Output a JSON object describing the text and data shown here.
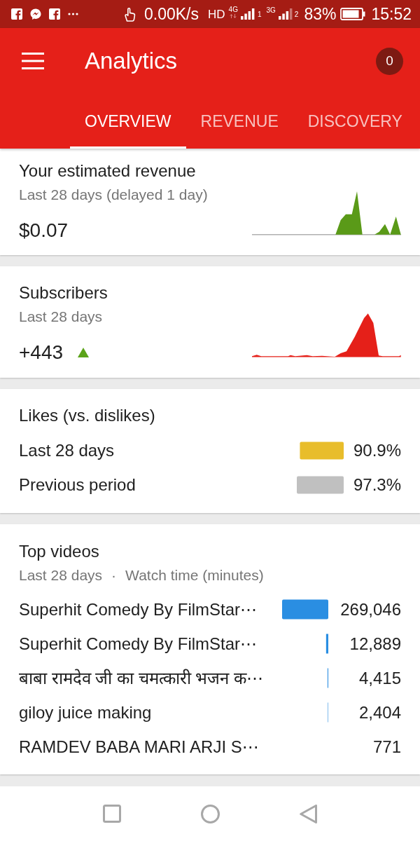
{
  "status_bar": {
    "network_speed": "0.00K/s",
    "hd": "HD",
    "sim_1": {
      "network": "4G",
      "slot": "1"
    },
    "sim_2": {
      "network": "3G",
      "slot": "2"
    },
    "battery": "83%",
    "time": "15:52"
  },
  "app_bar": {
    "title": "Analytics",
    "badge": "0"
  },
  "tabs": [
    {
      "label": "OVERVIEW",
      "selected": true
    },
    {
      "label": "REVENUE",
      "selected": false
    },
    {
      "label": "DISCOVERY",
      "selected": false
    }
  ],
  "revenue": {
    "title": "Your estimated revenue",
    "subtitle": "Last 28 days (delayed 1 day)",
    "value": "$0.07"
  },
  "subscribers": {
    "title": "Subscribers",
    "subtitle": "Last 28 days",
    "value": "+443",
    "trend_up": true
  },
  "likes": {
    "title": "Likes (vs. dislikes)",
    "bars": [
      {
        "color": "#e8bd2b"
      },
      {
        "color": "#c0c0c0"
      }
    ],
    "chart_data": {
      "type": "bar",
      "orientation": "horizontal",
      "categories": [
        "Last 28 days",
        "Previous period"
      ],
      "values": [
        90.9,
        97.3
      ],
      "value_labels": [
        "90.9%",
        "97.3%"
      ]
    }
  },
  "top_videos": {
    "title": "Top videos",
    "subtitle": [
      "Last 28 days",
      "·",
      "Watch time (minutes)"
    ],
    "chart_data": {
      "type": "bar",
      "orientation": "horizontal",
      "categories": [
        "Superhit Comedy By FilmStar⋯",
        "Superhit Comedy By FilmStar⋯",
        "बाबा रामदेव जी का चमत्कारी भजन क⋯",
        "giloy juice making",
        "RAMDEV BABA MARI ARJI S⋯"
      ],
      "values": [
        269046,
        12889,
        4415,
        2404,
        771
      ],
      "value_labels": [
        "269,046",
        "12,889",
        "4,415",
        "2,404",
        "771"
      ]
    }
  }
}
